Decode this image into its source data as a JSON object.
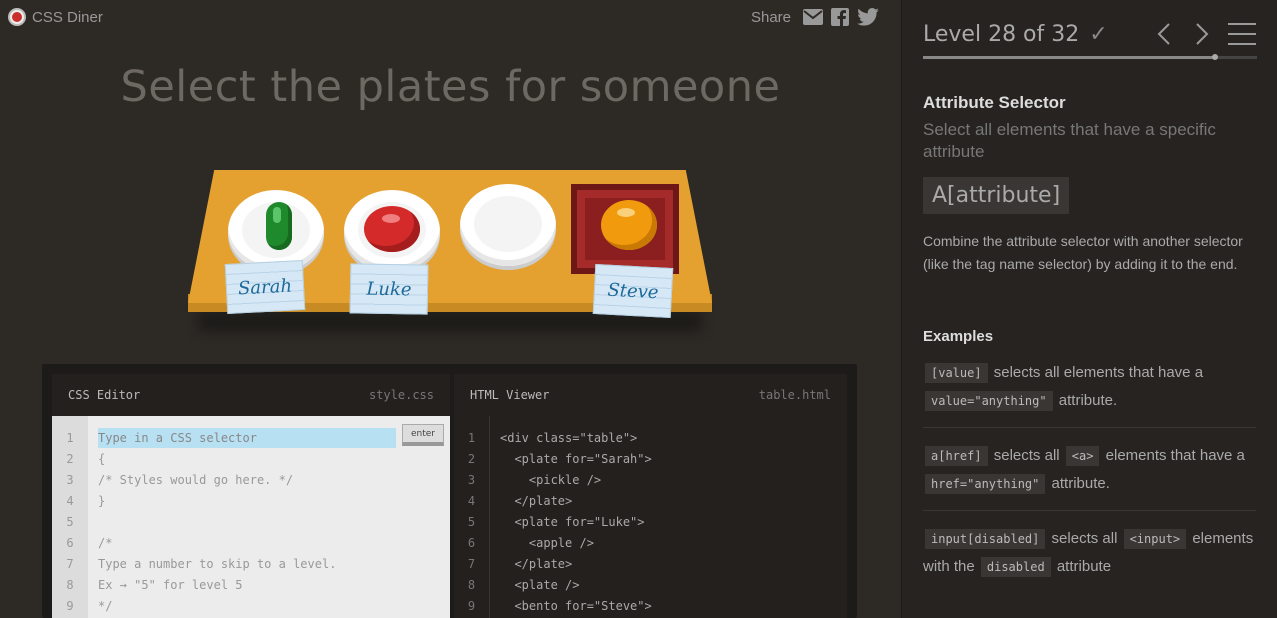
{
  "app": {
    "title": "CSS Diner"
  },
  "share": {
    "label": "Share"
  },
  "instruction": "Select the plates for someone",
  "table": {
    "tags": [
      "Sarah",
      "Luke",
      "Steve"
    ]
  },
  "css_editor": {
    "title": "CSS Editor",
    "file": "style.css",
    "placeholder": "Type in a CSS selector",
    "enter_label": "enter",
    "line_numbers": [
      "1",
      "2",
      "3",
      "4",
      "5",
      "6",
      "7",
      "8",
      "9"
    ],
    "lines": [
      "",
      "{",
      "/* Styles would go here. */",
      "}",
      "",
      "/*",
      "Type a number to skip to a level.",
      "Ex → \"5\" for level 5",
      "*/"
    ]
  },
  "html_viewer": {
    "title": "HTML Viewer",
    "file": "table.html",
    "line_numbers": [
      "1",
      "2",
      "3",
      "4",
      "5",
      "6",
      "7",
      "8",
      "9"
    ],
    "lines": [
      "<div class=\"table\">",
      "  <plate for=\"Sarah\">",
      "    <pickle />",
      "  </plate>",
      "  <plate for=\"Luke\">",
      "    <apple />",
      "  </plate>",
      "  <plate />",
      "  <bento for=\"Steve\">"
    ]
  },
  "sidebar": {
    "level_label": "Level 28 of 32",
    "progress": 0.875,
    "selector_name": "Attribute Selector",
    "selector_title": "Select all elements that have a specific attribute",
    "syntax": "A[attribute]",
    "hint": "Combine the attribute selector with another selector (like the tag name selector) by adding it to the end.",
    "examples_title": "Examples",
    "examples": [
      {
        "c1": "[value]",
        "t1": "selects all elements that have a",
        "c2": "value=\"anything\"",
        "t2": "attribute."
      },
      {
        "c1": "a[href]",
        "t1": "selects all",
        "c2": "<a>",
        "t2": "elements that have a",
        "c3": "href=\"anything\"",
        "t3": "attribute."
      },
      {
        "c1": "input[disabled]",
        "t1": "selects all",
        "c2": "<input>",
        "t2": "elements with the",
        "c3": "disabled",
        "t3": "attribute"
      }
    ]
  },
  "colors": {
    "table": "#e4a130",
    "pickle": "#1f8a2c",
    "apple": "#d42a2a",
    "orange": "#f29a0e",
    "bento": "#8b1f1f",
    "input_highlight": "#b7e0f3"
  }
}
